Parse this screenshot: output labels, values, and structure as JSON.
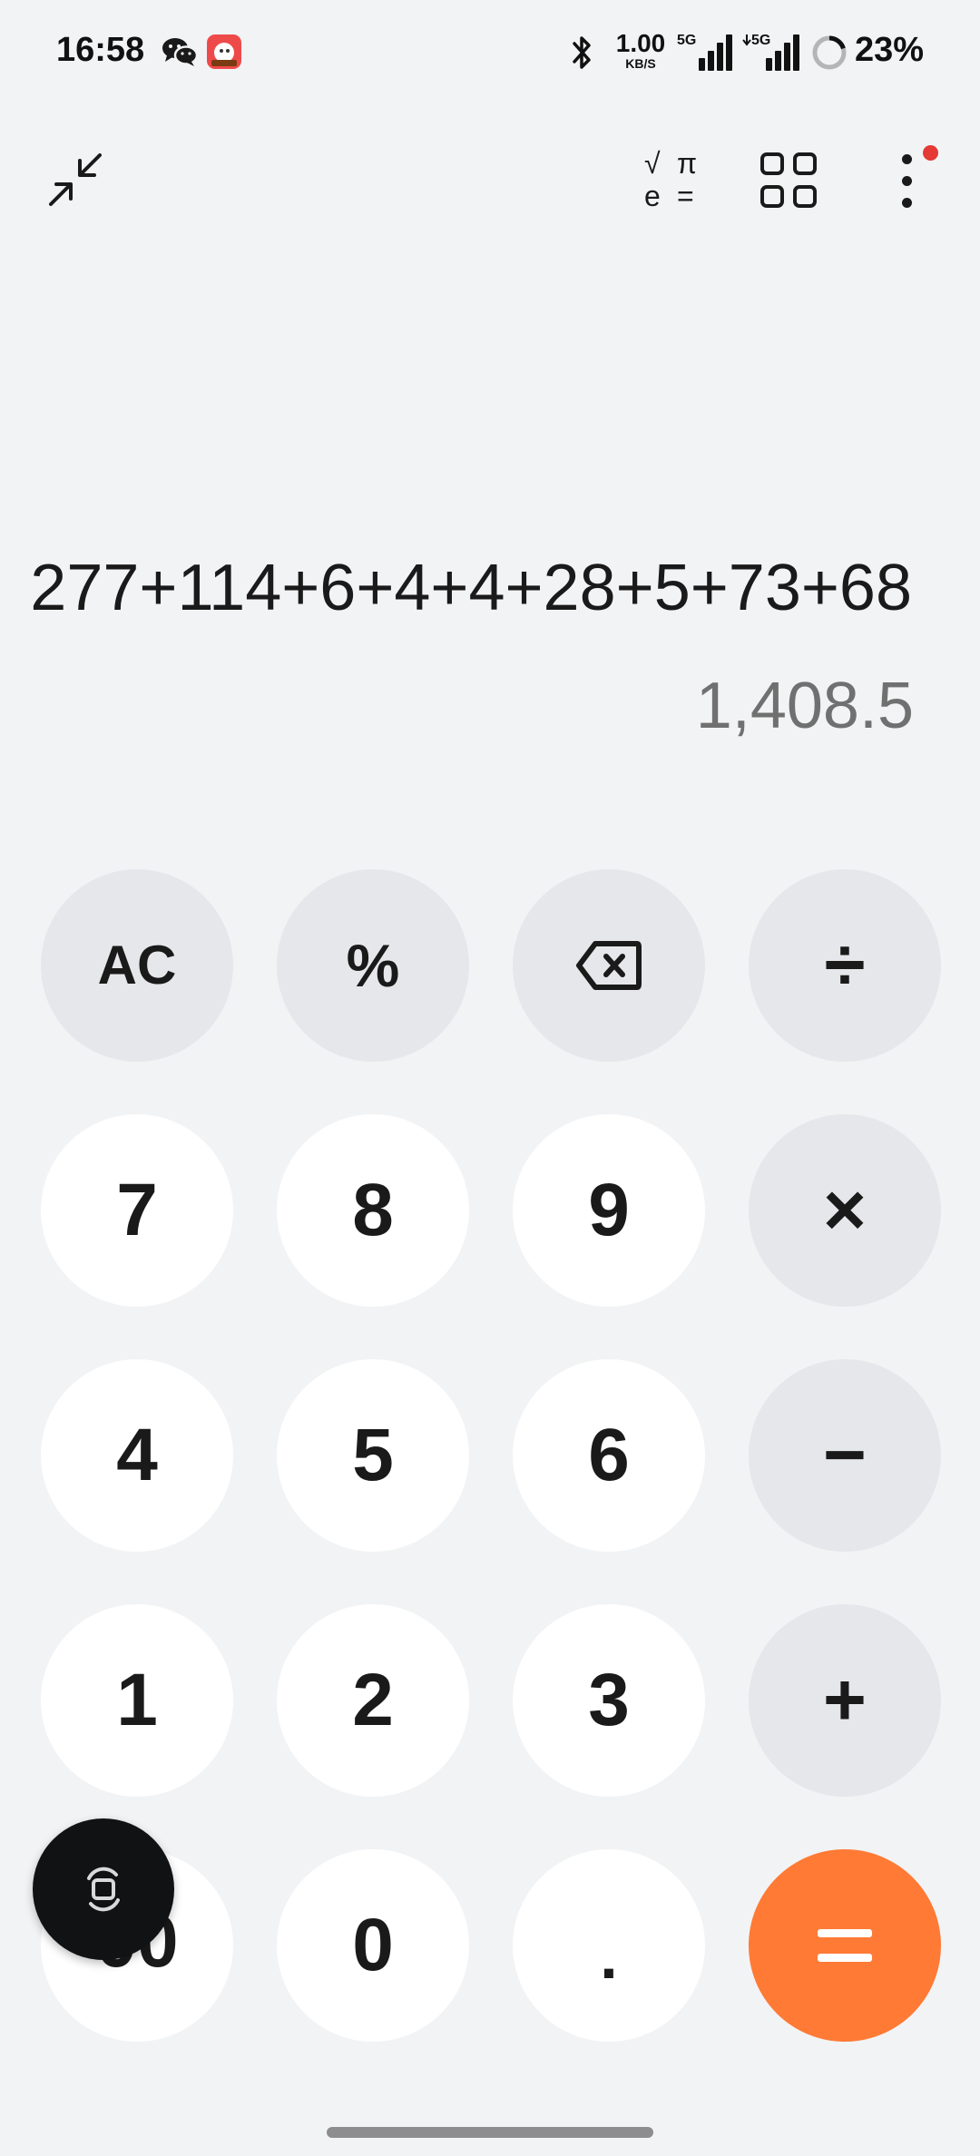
{
  "status_bar": {
    "time": "16:58",
    "network_speed_value": "1.00",
    "network_speed_unit": "KB/S",
    "sim1_label": "5G",
    "sim2_label": "5G",
    "battery_percent": "23%",
    "icons": [
      "wechat-icon",
      "app-notification-icon",
      "bluetooth-icon",
      "signal-icon",
      "battery-ring-icon"
    ]
  },
  "toolbar": {
    "collapse_icon": "collapse-arrows-icon",
    "scientific": {
      "sqrt": "√",
      "pi": "π",
      "e": "e",
      "equals": "="
    },
    "grid_icon": "grid-icon",
    "more_icon": "more-vertical-icon",
    "notification_dot_color": "#e53935"
  },
  "display": {
    "expression": "277+114+6+4+4+28+5+73+68",
    "result": "1,408.5"
  },
  "keypad": {
    "row1": {
      "clear": "AC",
      "percent": "%",
      "backspace_icon": "backspace-icon",
      "divide": "÷"
    },
    "row2": {
      "seven": "7",
      "eight": "8",
      "nine": "9",
      "multiply": "×"
    },
    "row3": {
      "four": "4",
      "five": "5",
      "six": "6",
      "minus": "−"
    },
    "row4": {
      "one": "1",
      "two": "2",
      "three": "3",
      "plus": "+"
    },
    "row5": {
      "double_zero": "00",
      "zero": "0",
      "decimal": ".",
      "equals": "="
    }
  },
  "colors": {
    "background": "#f2f3f5",
    "number_key": "#ffffff",
    "function_key": "#e6e7ea",
    "equals_key": "#ff7a35",
    "result_text": "#707070"
  },
  "floating_button_icon": "screen-rotate-icon"
}
